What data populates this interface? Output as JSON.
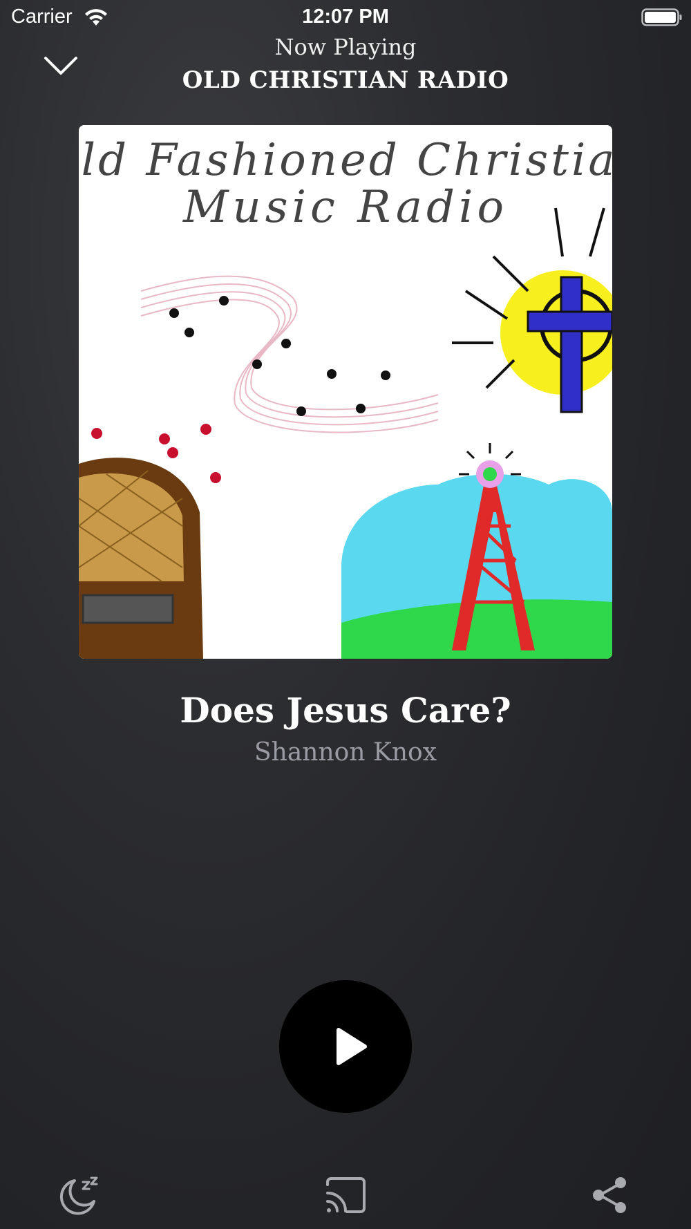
{
  "status_bar": {
    "carrier": "Carrier",
    "time": "12:07 PM",
    "icons": [
      "wifi-icon",
      "battery-icon"
    ]
  },
  "header": {
    "subtitle": "Now Playing",
    "station": "OLD CHRISTIAN RADIO",
    "collapse_icon": "chevron-down-icon"
  },
  "artwork": {
    "line1": "Old Fashioned Christian",
    "line2": "Music Radio"
  },
  "track": {
    "title": "Does Jesus Care?",
    "artist": "Shannon Knox"
  },
  "controls": {
    "play_icon": "play-icon",
    "bottom_icons": [
      "sleep-timer-icon",
      "cast-icon",
      "share-icon"
    ]
  },
  "colors": {
    "background": "#2c2d30",
    "artist_text": "#9a9ca3",
    "play_button": "#000000"
  }
}
